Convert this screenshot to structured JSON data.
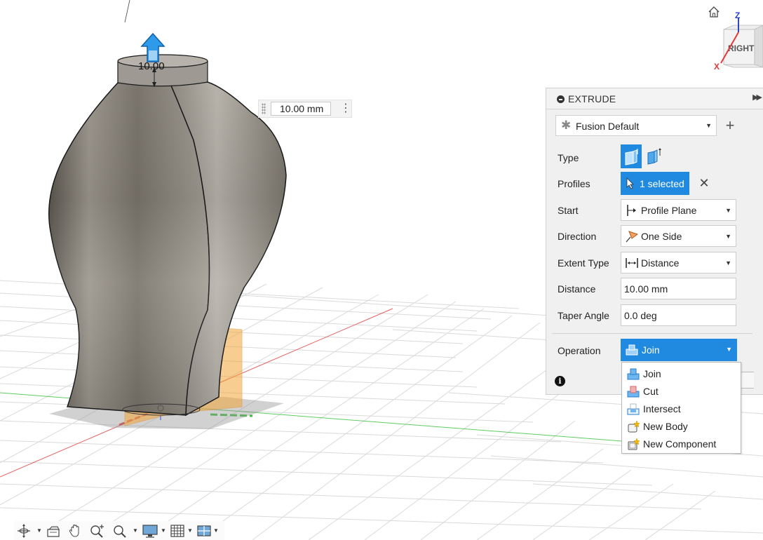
{
  "viewport": {
    "dimension_label": "10.00",
    "distance_input": "10.00 mm"
  },
  "viewcube": {
    "face": "RIGHT",
    "axis_z": "Z",
    "axis_x": "X"
  },
  "panel": {
    "title": "EXTRUDE",
    "preset": "Fusion Default",
    "rows": {
      "type_label": "Type",
      "profiles_label": "Profiles",
      "profiles_value": "1 selected",
      "start_label": "Start",
      "start_value": "Profile Plane",
      "direction_label": "Direction",
      "direction_value": "One Side",
      "extent_label": "Extent Type",
      "extent_value": "Distance",
      "distance_label": "Distance",
      "distance_value": "10.00 mm",
      "taper_label": "Taper Angle",
      "taper_value": "0.0 deg",
      "operation_label": "Operation",
      "operation_value": "Join"
    }
  },
  "operation_menu": {
    "items": [
      "Join",
      "Cut",
      "Intersect",
      "New Body",
      "New Component"
    ]
  },
  "colors": {
    "accent": "#1f8ae0",
    "sketch_orange": "#f2a53a",
    "axis_red": "#e03b3b",
    "axis_green": "#38c03a"
  },
  "toolbar": {
    "icons": [
      "orbit-icon",
      "look-at-icon",
      "pan-icon",
      "zoom-icon",
      "zoom-window-icon",
      "display-settings-icon",
      "grid-icon",
      "viewports-icon"
    ]
  }
}
